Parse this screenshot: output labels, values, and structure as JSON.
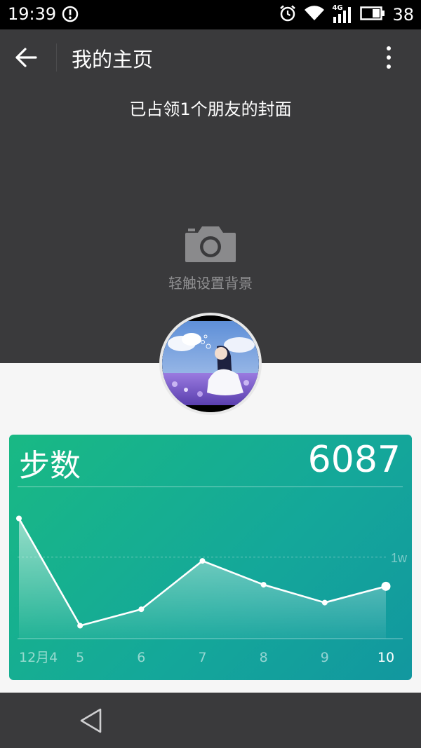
{
  "status_bar": {
    "time": "19:39",
    "network": "4G",
    "battery_level": "38",
    "icons": [
      "alert-icon",
      "alarm-icon",
      "wifi-icon",
      "signal-icon",
      "battery-icon"
    ]
  },
  "app_bar": {
    "title": "我的主页",
    "icons": [
      "back-arrow-icon",
      "more-vertical-icon"
    ]
  },
  "cover": {
    "notice": "已占领1个朋友的封面",
    "set_background_label": "轻触设置背景",
    "icons": [
      "camera-icon"
    ]
  },
  "steps_card": {
    "title": "步数",
    "value": "6087",
    "colors": {
      "gradient_start": "#19b984",
      "gradient_end": "#12979f"
    }
  },
  "chart_data": {
    "type": "line",
    "title": "步数",
    "categories": [
      "12月4",
      "5",
      "6",
      "7",
      "8",
      "9",
      "10"
    ],
    "values": [
      15200,
      800,
      3000,
      9500,
      6300,
      3900,
      6087
    ],
    "reference_line": {
      "value": 10000,
      "label": "1w"
    },
    "ylim": [
      0,
      16000
    ],
    "grid": false,
    "highlight_last": true
  },
  "nav_bar": {
    "icons": [
      "nav-back-icon"
    ]
  }
}
